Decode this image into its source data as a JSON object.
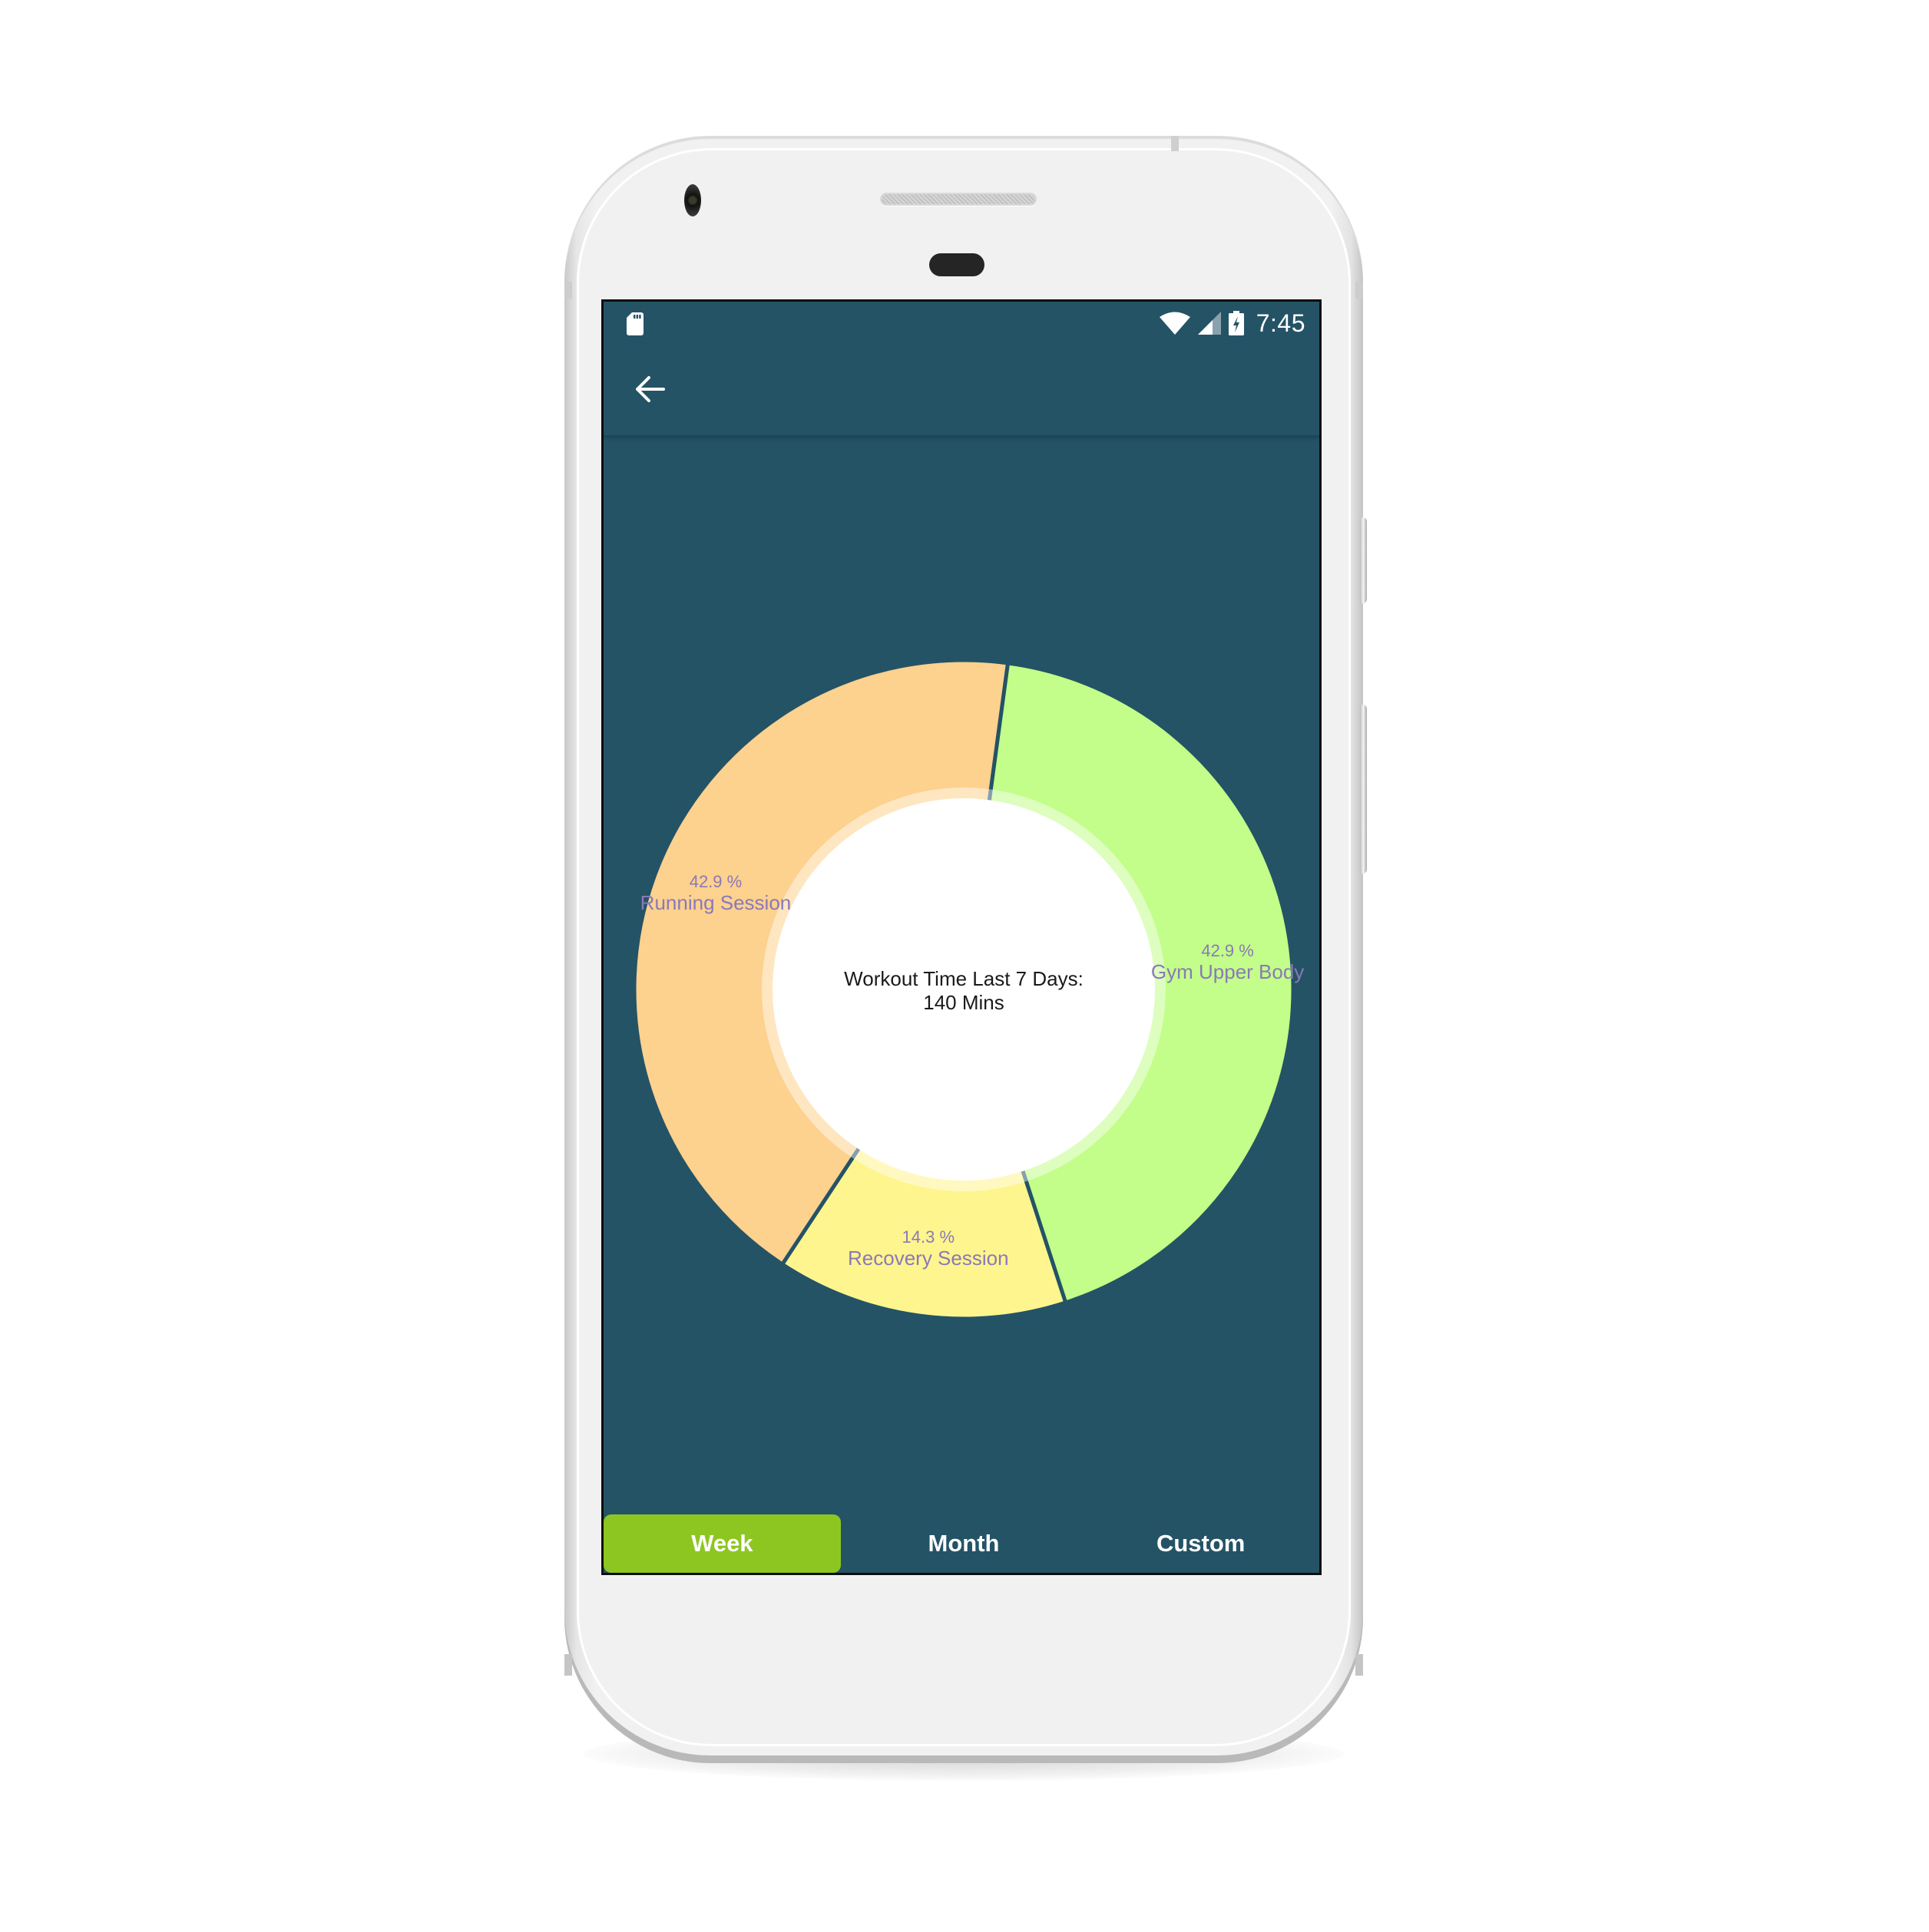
{
  "status_bar": {
    "left_icon": "sd-card-icon",
    "icons": [
      "wifi-icon",
      "cell-signal-icon",
      "battery-charging-icon"
    ],
    "time": "7:45"
  },
  "app_bar": {
    "back_icon": "arrow-back-icon"
  },
  "center_label": {
    "line1": "Workout Time Last 7 Days:",
    "line2": "140 Mins"
  },
  "tabs": [
    {
      "label": "Week",
      "active": true
    },
    {
      "label": "Month",
      "active": false
    },
    {
      "label": "Custom",
      "active": false
    }
  ],
  "colors": {
    "background": "#245366",
    "active_tab": "#8dc621",
    "slice_label": "#8a79b8"
  },
  "chart_data": {
    "type": "pie",
    "variant": "donut",
    "title": "Workout Time Last 7 Days: 140 Mins",
    "categories": [
      "Gym Upper Body",
      "Recovery Session",
      "Running Session"
    ],
    "values": [
      42.9,
      14.3,
      42.9
    ],
    "unit": "%",
    "labels": [
      "42.9 %",
      "14.3 %",
      "42.9 %"
    ],
    "colors": [
      "#c2fe89",
      "#fff58e",
      "#fdd18e"
    ],
    "start_angle_deg": 7.7,
    "legend": "none"
  }
}
